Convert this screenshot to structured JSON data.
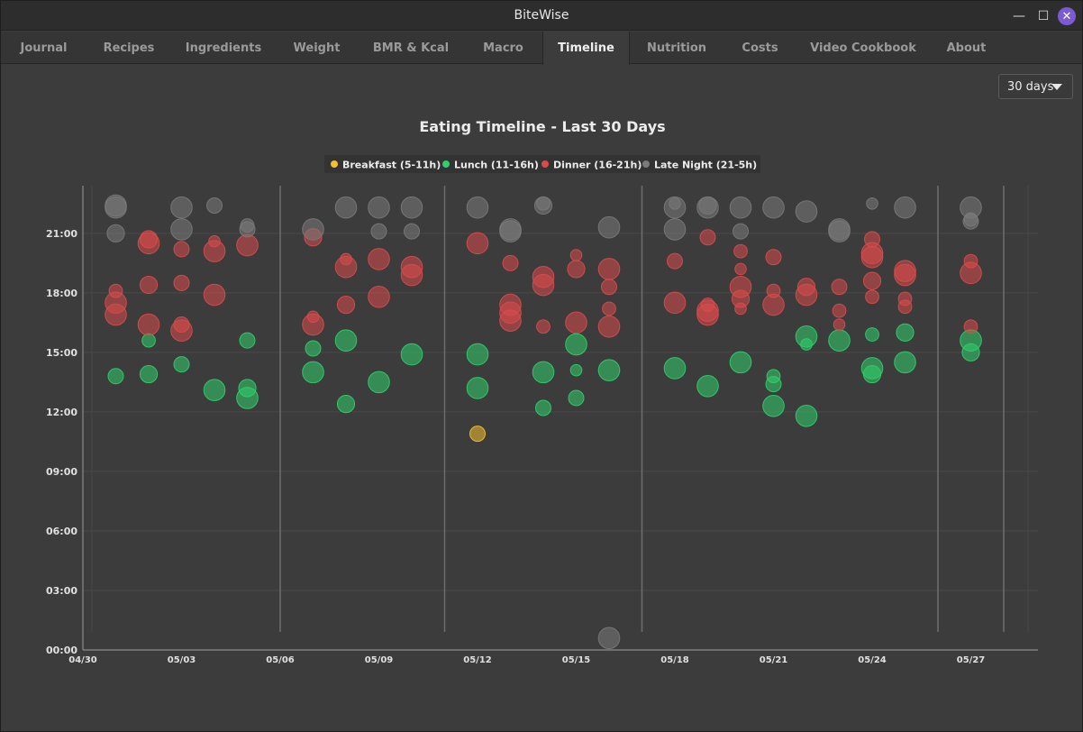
{
  "window": {
    "title": "BiteWise"
  },
  "tabs": [
    "Journal",
    "Recipes",
    "Ingredients",
    "Weight",
    "BMR & Kcal",
    "Macro",
    "Timeline",
    "Nutrition",
    "Costs",
    "Video Cookbook",
    "About"
  ],
  "active_tab": "Timeline",
  "range_select": {
    "value": "30 days"
  },
  "colors": {
    "breakfast": "#f2c02e",
    "lunch": "#2fd06a",
    "dinner": "#d94b4b",
    "latenight": "#7a7a7a",
    "bg": "#3c3c3c"
  },
  "chart_data": {
    "type": "scatter",
    "title": "Eating Timeline - Last 30 Days",
    "xlabel": "",
    "ylabel": "",
    "x_ticks": [
      "04/30",
      "05/03",
      "05/06",
      "05/09",
      "05/12",
      "05/15",
      "05/18",
      "05/21",
      "05/24",
      "05/27"
    ],
    "y_ticks": [
      "00:00",
      "03:00",
      "06:00",
      "09:00",
      "12:00",
      "15:00",
      "18:00",
      "21:00"
    ],
    "ylim": [
      0,
      23.4
    ],
    "xlim": [
      "04/30",
      "05/29"
    ],
    "grid": true,
    "legend_position": "top-center",
    "vertical_markers": [
      "05/06",
      "05/11",
      "05/17",
      "05/26",
      "05/28"
    ],
    "legend": [
      "Breakfast (5-11h)",
      "Lunch (11-16h)",
      "Dinner (16-21h)",
      "Late Night (21-5h)"
    ],
    "series": [
      {
        "name": "Breakfast (5-11h)",
        "points": [
          {
            "x": "05/12",
            "y": 10.9,
            "size": 5
          }
        ]
      },
      {
        "name": "Lunch (11-16h)",
        "points": [
          {
            "x": "05/01",
            "y": 13.8,
            "size": 5
          },
          {
            "x": "05/02",
            "y": 13.9,
            "size": 6
          },
          {
            "x": "05/02",
            "y": 15.6,
            "size": 4
          },
          {
            "x": "05/03",
            "y": 14.4,
            "size": 5
          },
          {
            "x": "05/04",
            "y": 13.1,
            "size": 8
          },
          {
            "x": "05/05",
            "y": 12.7,
            "size": 8
          },
          {
            "x": "05/05",
            "y": 13.2,
            "size": 6
          },
          {
            "x": "05/05",
            "y": 15.6,
            "size": 5
          },
          {
            "x": "05/07",
            "y": 14.0,
            "size": 8
          },
          {
            "x": "05/07",
            "y": 15.2,
            "size": 5
          },
          {
            "x": "05/08",
            "y": 12.4,
            "size": 6
          },
          {
            "x": "05/08",
            "y": 15.6,
            "size": 8
          },
          {
            "x": "05/09",
            "y": 13.5,
            "size": 8
          },
          {
            "x": "05/10",
            "y": 14.9,
            "size": 8
          },
          {
            "x": "05/12",
            "y": 13.2,
            "size": 8
          },
          {
            "x": "05/12",
            "y": 14.9,
            "size": 8
          },
          {
            "x": "05/14",
            "y": 12.2,
            "size": 5
          },
          {
            "x": "05/14",
            "y": 14.0,
            "size": 8
          },
          {
            "x": "05/15",
            "y": 12.7,
            "size": 5
          },
          {
            "x": "05/15",
            "y": 14.1,
            "size": 3
          },
          {
            "x": "05/15",
            "y": 15.4,
            "size": 8
          },
          {
            "x": "05/16",
            "y": 14.1,
            "size": 8
          },
          {
            "x": "05/18",
            "y": 14.2,
            "size": 8
          },
          {
            "x": "05/19",
            "y": 13.3,
            "size": 8
          },
          {
            "x": "05/20",
            "y": 14.5,
            "size": 8
          },
          {
            "x": "05/21",
            "y": 12.3,
            "size": 8
          },
          {
            "x": "05/21",
            "y": 13.4,
            "size": 5
          },
          {
            "x": "05/21",
            "y": 13.8,
            "size": 4
          },
          {
            "x": "05/22",
            "y": 11.8,
            "size": 8
          },
          {
            "x": "05/22",
            "y": 15.4,
            "size": 3
          },
          {
            "x": "05/22",
            "y": 15.8,
            "size": 8
          },
          {
            "x": "05/23",
            "y": 15.6,
            "size": 8
          },
          {
            "x": "05/24",
            "y": 13.9,
            "size": 6
          },
          {
            "x": "05/24",
            "y": 14.2,
            "size": 8
          },
          {
            "x": "05/24",
            "y": 15.9,
            "size": 4
          },
          {
            "x": "05/25",
            "y": 14.5,
            "size": 8
          },
          {
            "x": "05/25",
            "y": 16.0,
            "size": 6
          },
          {
            "x": "05/27",
            "y": 15.0,
            "size": 6
          },
          {
            "x": "05/27",
            "y": 15.6,
            "size": 8
          }
        ]
      },
      {
        "name": "Dinner (16-21h)",
        "points": [
          {
            "x": "05/01",
            "y": 16.9,
            "size": 8
          },
          {
            "x": "05/01",
            "y": 17.5,
            "size": 8
          },
          {
            "x": "05/01",
            "y": 18.1,
            "size": 4
          },
          {
            "x": "05/02",
            "y": 16.4,
            "size": 8
          },
          {
            "x": "05/02",
            "y": 18.4,
            "size": 6
          },
          {
            "x": "05/02",
            "y": 20.5,
            "size": 8
          },
          {
            "x": "05/02",
            "y": 20.7,
            "size": 6
          },
          {
            "x": "05/03",
            "y": 16.1,
            "size": 8
          },
          {
            "x": "05/03",
            "y": 16.4,
            "size": 5
          },
          {
            "x": "05/03",
            "y": 18.5,
            "size": 5
          },
          {
            "x": "05/03",
            "y": 20.2,
            "size": 5
          },
          {
            "x": "05/04",
            "y": 17.9,
            "size": 8
          },
          {
            "x": "05/04",
            "y": 20.1,
            "size": 8
          },
          {
            "x": "05/04",
            "y": 20.6,
            "size": 3
          },
          {
            "x": "05/05",
            "y": 20.4,
            "size": 8
          },
          {
            "x": "05/07",
            "y": 16.4,
            "size": 8
          },
          {
            "x": "05/07",
            "y": 16.8,
            "size": 3
          },
          {
            "x": "05/07",
            "y": 20.8,
            "size": 6
          },
          {
            "x": "05/08",
            "y": 17.4,
            "size": 6
          },
          {
            "x": "05/08",
            "y": 19.3,
            "size": 8
          },
          {
            "x": "05/08",
            "y": 19.7,
            "size": 3
          },
          {
            "x": "05/09",
            "y": 17.8,
            "size": 8
          },
          {
            "x": "05/09",
            "y": 19.7,
            "size": 8
          },
          {
            "x": "05/10",
            "y": 18.9,
            "size": 8
          },
          {
            "x": "05/10",
            "y": 19.3,
            "size": 8
          },
          {
            "x": "05/12",
            "y": 20.5,
            "size": 8
          },
          {
            "x": "05/13",
            "y": 16.6,
            "size": 8
          },
          {
            "x": "05/13",
            "y": 17.0,
            "size": 8
          },
          {
            "x": "05/13",
            "y": 17.4,
            "size": 8
          },
          {
            "x": "05/13",
            "y": 19.5,
            "size": 5
          },
          {
            "x": "05/14",
            "y": 16.3,
            "size": 4
          },
          {
            "x": "05/14",
            "y": 18.4,
            "size": 8
          },
          {
            "x": "05/14",
            "y": 18.8,
            "size": 8
          },
          {
            "x": "05/15",
            "y": 16.5,
            "size": 8
          },
          {
            "x": "05/15",
            "y": 19.2,
            "size": 6
          },
          {
            "x": "05/15",
            "y": 19.9,
            "size": 3
          },
          {
            "x": "05/16",
            "y": 16.3,
            "size": 8
          },
          {
            "x": "05/16",
            "y": 17.2,
            "size": 4
          },
          {
            "x": "05/16",
            "y": 18.3,
            "size": 5
          },
          {
            "x": "05/16",
            "y": 19.2,
            "size": 8
          },
          {
            "x": "05/18",
            "y": 17.5,
            "size": 8
          },
          {
            "x": "05/18",
            "y": 19.6,
            "size": 5
          },
          {
            "x": "05/19",
            "y": 16.9,
            "size": 8
          },
          {
            "x": "05/19",
            "y": 17.1,
            "size": 8
          },
          {
            "x": "05/19",
            "y": 17.4,
            "size": 4
          },
          {
            "x": "05/19",
            "y": 20.8,
            "size": 5
          },
          {
            "x": "05/20",
            "y": 17.2,
            "size": 3
          },
          {
            "x": "05/20",
            "y": 17.7,
            "size": 6
          },
          {
            "x": "05/20",
            "y": 18.3,
            "size": 8
          },
          {
            "x": "05/20",
            "y": 19.2,
            "size": 3
          },
          {
            "x": "05/20",
            "y": 20.1,
            "size": 4
          },
          {
            "x": "05/21",
            "y": 17.4,
            "size": 8
          },
          {
            "x": "05/21",
            "y": 18.1,
            "size": 4
          },
          {
            "x": "05/21",
            "y": 19.8,
            "size": 5
          },
          {
            "x": "05/22",
            "y": 17.9,
            "size": 8
          },
          {
            "x": "05/22",
            "y": 18.3,
            "size": 6
          },
          {
            "x": "05/23",
            "y": 16.4,
            "size": 3
          },
          {
            "x": "05/23",
            "y": 17.1,
            "size": 4
          },
          {
            "x": "05/23",
            "y": 18.3,
            "size": 5
          },
          {
            "x": "05/24",
            "y": 17.8,
            "size": 4
          },
          {
            "x": "05/24",
            "y": 18.6,
            "size": 6
          },
          {
            "x": "05/24",
            "y": 19.8,
            "size": 8
          },
          {
            "x": "05/24",
            "y": 20.0,
            "size": 8
          },
          {
            "x": "05/24",
            "y": 20.7,
            "size": 5
          },
          {
            "x": "05/25",
            "y": 17.3,
            "size": 4
          },
          {
            "x": "05/25",
            "y": 17.7,
            "size": 4
          },
          {
            "x": "05/25",
            "y": 18.9,
            "size": 8
          },
          {
            "x": "05/25",
            "y": 19.1,
            "size": 8
          },
          {
            "x": "05/27",
            "y": 16.3,
            "size": 4
          },
          {
            "x": "05/27",
            "y": 19.0,
            "size": 8
          },
          {
            "x": "05/27",
            "y": 19.6,
            "size": 4
          }
        ]
      },
      {
        "name": "Late Night (21-5h)",
        "points": [
          {
            "x": "05/01",
            "y": 21.0,
            "size": 6
          },
          {
            "x": "05/01",
            "y": 22.3,
            "size": 8
          },
          {
            "x": "05/01",
            "y": 22.4,
            "size": 8
          },
          {
            "x": "05/03",
            "y": 21.2,
            "size": 8
          },
          {
            "x": "05/03",
            "y": 22.3,
            "size": 8
          },
          {
            "x": "05/04",
            "y": 22.4,
            "size": 5
          },
          {
            "x": "05/05",
            "y": 21.2,
            "size": 5
          },
          {
            "x": "05/05",
            "y": 21.4,
            "size": 4
          },
          {
            "x": "05/07",
            "y": 21.2,
            "size": 8
          },
          {
            "x": "05/08",
            "y": 22.3,
            "size": 8
          },
          {
            "x": "05/09",
            "y": 21.1,
            "size": 5
          },
          {
            "x": "05/09",
            "y": 22.3,
            "size": 8
          },
          {
            "x": "05/10",
            "y": 21.1,
            "size": 5
          },
          {
            "x": "05/10",
            "y": 22.3,
            "size": 8
          },
          {
            "x": "05/12",
            "y": 22.3,
            "size": 8
          },
          {
            "x": "05/13",
            "y": 21.1,
            "size": 8
          },
          {
            "x": "05/13",
            "y": 21.2,
            "size": 8
          },
          {
            "x": "05/14",
            "y": 22.4,
            "size": 6
          },
          {
            "x": "05/14",
            "y": 22.5,
            "size": 4
          },
          {
            "x": "05/16",
            "y": 0.6,
            "size": 8
          },
          {
            "x": "05/16",
            "y": 21.3,
            "size": 8
          },
          {
            "x": "05/18",
            "y": 21.2,
            "size": 8
          },
          {
            "x": "05/18",
            "y": 22.3,
            "size": 8
          },
          {
            "x": "05/18",
            "y": 22.5,
            "size": 3
          },
          {
            "x": "05/19",
            "y": 22.3,
            "size": 8
          },
          {
            "x": "05/19",
            "y": 22.4,
            "size": 6
          },
          {
            "x": "05/20",
            "y": 21.1,
            "size": 5
          },
          {
            "x": "05/20",
            "y": 22.3,
            "size": 8
          },
          {
            "x": "05/21",
            "y": 22.3,
            "size": 8
          },
          {
            "x": "05/22",
            "y": 22.1,
            "size": 8
          },
          {
            "x": "05/23",
            "y": 21.1,
            "size": 8
          },
          {
            "x": "05/23",
            "y": 21.2,
            "size": 8
          },
          {
            "x": "05/24",
            "y": 22.5,
            "size": 3
          },
          {
            "x": "05/25",
            "y": 22.3,
            "size": 8
          },
          {
            "x": "05/27",
            "y": 21.6,
            "size": 5
          },
          {
            "x": "05/27",
            "y": 21.7,
            "size": 4
          },
          {
            "x": "05/27",
            "y": 22.3,
            "size": 8
          }
        ]
      }
    ]
  }
}
